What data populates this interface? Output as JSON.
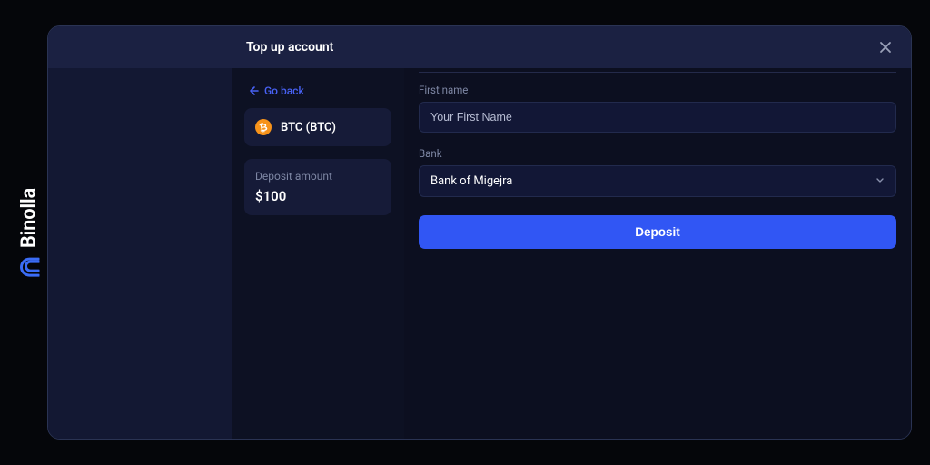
{
  "brand": {
    "name": "Binolla"
  },
  "header": {
    "title": "Top up account"
  },
  "nav": {
    "go_back": "Go back"
  },
  "method": {
    "icon": "btc-icon",
    "label": "BTC (BTC)"
  },
  "deposit_summary": {
    "label": "Deposit amount",
    "value": "$100"
  },
  "form": {
    "first_name": {
      "label": "First name",
      "placeholder": "Your First Name",
      "value": ""
    },
    "bank": {
      "label": "Bank",
      "selected": "Bank of Migejra"
    },
    "submit_label": "Deposit"
  },
  "colors": {
    "accent": "#3156f4",
    "link": "#4862f5",
    "btc": "#f7931a"
  }
}
